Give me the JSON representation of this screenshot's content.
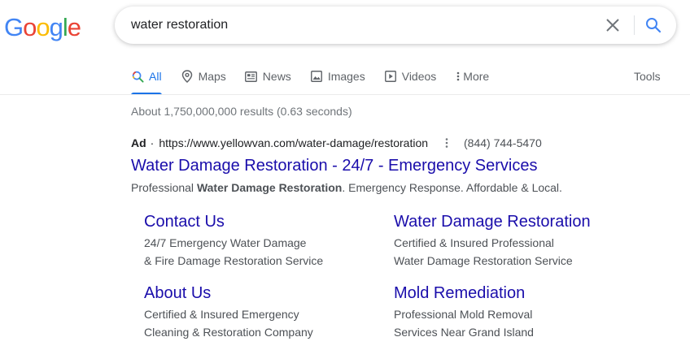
{
  "logo": {
    "letters": [
      "G",
      "o",
      "o",
      "g",
      "l",
      "e"
    ],
    "colors": [
      "#4285f4",
      "#ea4335",
      "#fbbc05",
      "#4285f4",
      "#34a853",
      "#ea4335"
    ]
  },
  "search": {
    "value": "water restoration",
    "clear_icon": "close-icon",
    "search_icon": "search-icon"
  },
  "tabs": [
    {
      "label": "All",
      "icon": "search-icon",
      "active": true
    },
    {
      "label": "Maps",
      "icon": "map-pin-icon",
      "active": false
    },
    {
      "label": "News",
      "icon": "news-icon",
      "active": false
    },
    {
      "label": "Images",
      "icon": "image-icon",
      "active": false
    },
    {
      "label": "Videos",
      "icon": "video-icon",
      "active": false
    },
    {
      "label": "More",
      "icon": "more-vert-icon",
      "active": false
    }
  ],
  "tools_label": "Tools",
  "stats": "About 1,750,000,000 results (0.63 seconds)",
  "ad": {
    "label": "Ad",
    "separator": "·",
    "url": "https://www.yellowvan.com/water-damage/restoration",
    "phone": "(844) 744-5470",
    "title": "Water Damage Restoration - 24/7 - Emergency Services",
    "desc_prefix": "Professional ",
    "desc_bold": "Water Damage Restoration",
    "desc_suffix": ". Emergency Response. Affordable & Local."
  },
  "sitelinks": [
    {
      "title": "Contact Us",
      "lines": [
        "24/7 Emergency Water Damage",
        "& Fire Damage Restoration Service"
      ]
    },
    {
      "title": "Water Damage Restoration",
      "lines": [
        "Certified & Insured Professional",
        "Water Damage Restoration Service"
      ]
    },
    {
      "title": "About Us",
      "lines": [
        "Certified & Insured Emergency",
        "Cleaning & Restoration Company"
      ]
    },
    {
      "title": "Mold Remediation",
      "lines": [
        "Professional Mold Removal",
        "Services Near Grand Island"
      ]
    }
  ],
  "colors": {
    "link": "#1a0dab",
    "accent": "#1a73e8",
    "muted": "#5f6368",
    "body": "#4d5156"
  }
}
